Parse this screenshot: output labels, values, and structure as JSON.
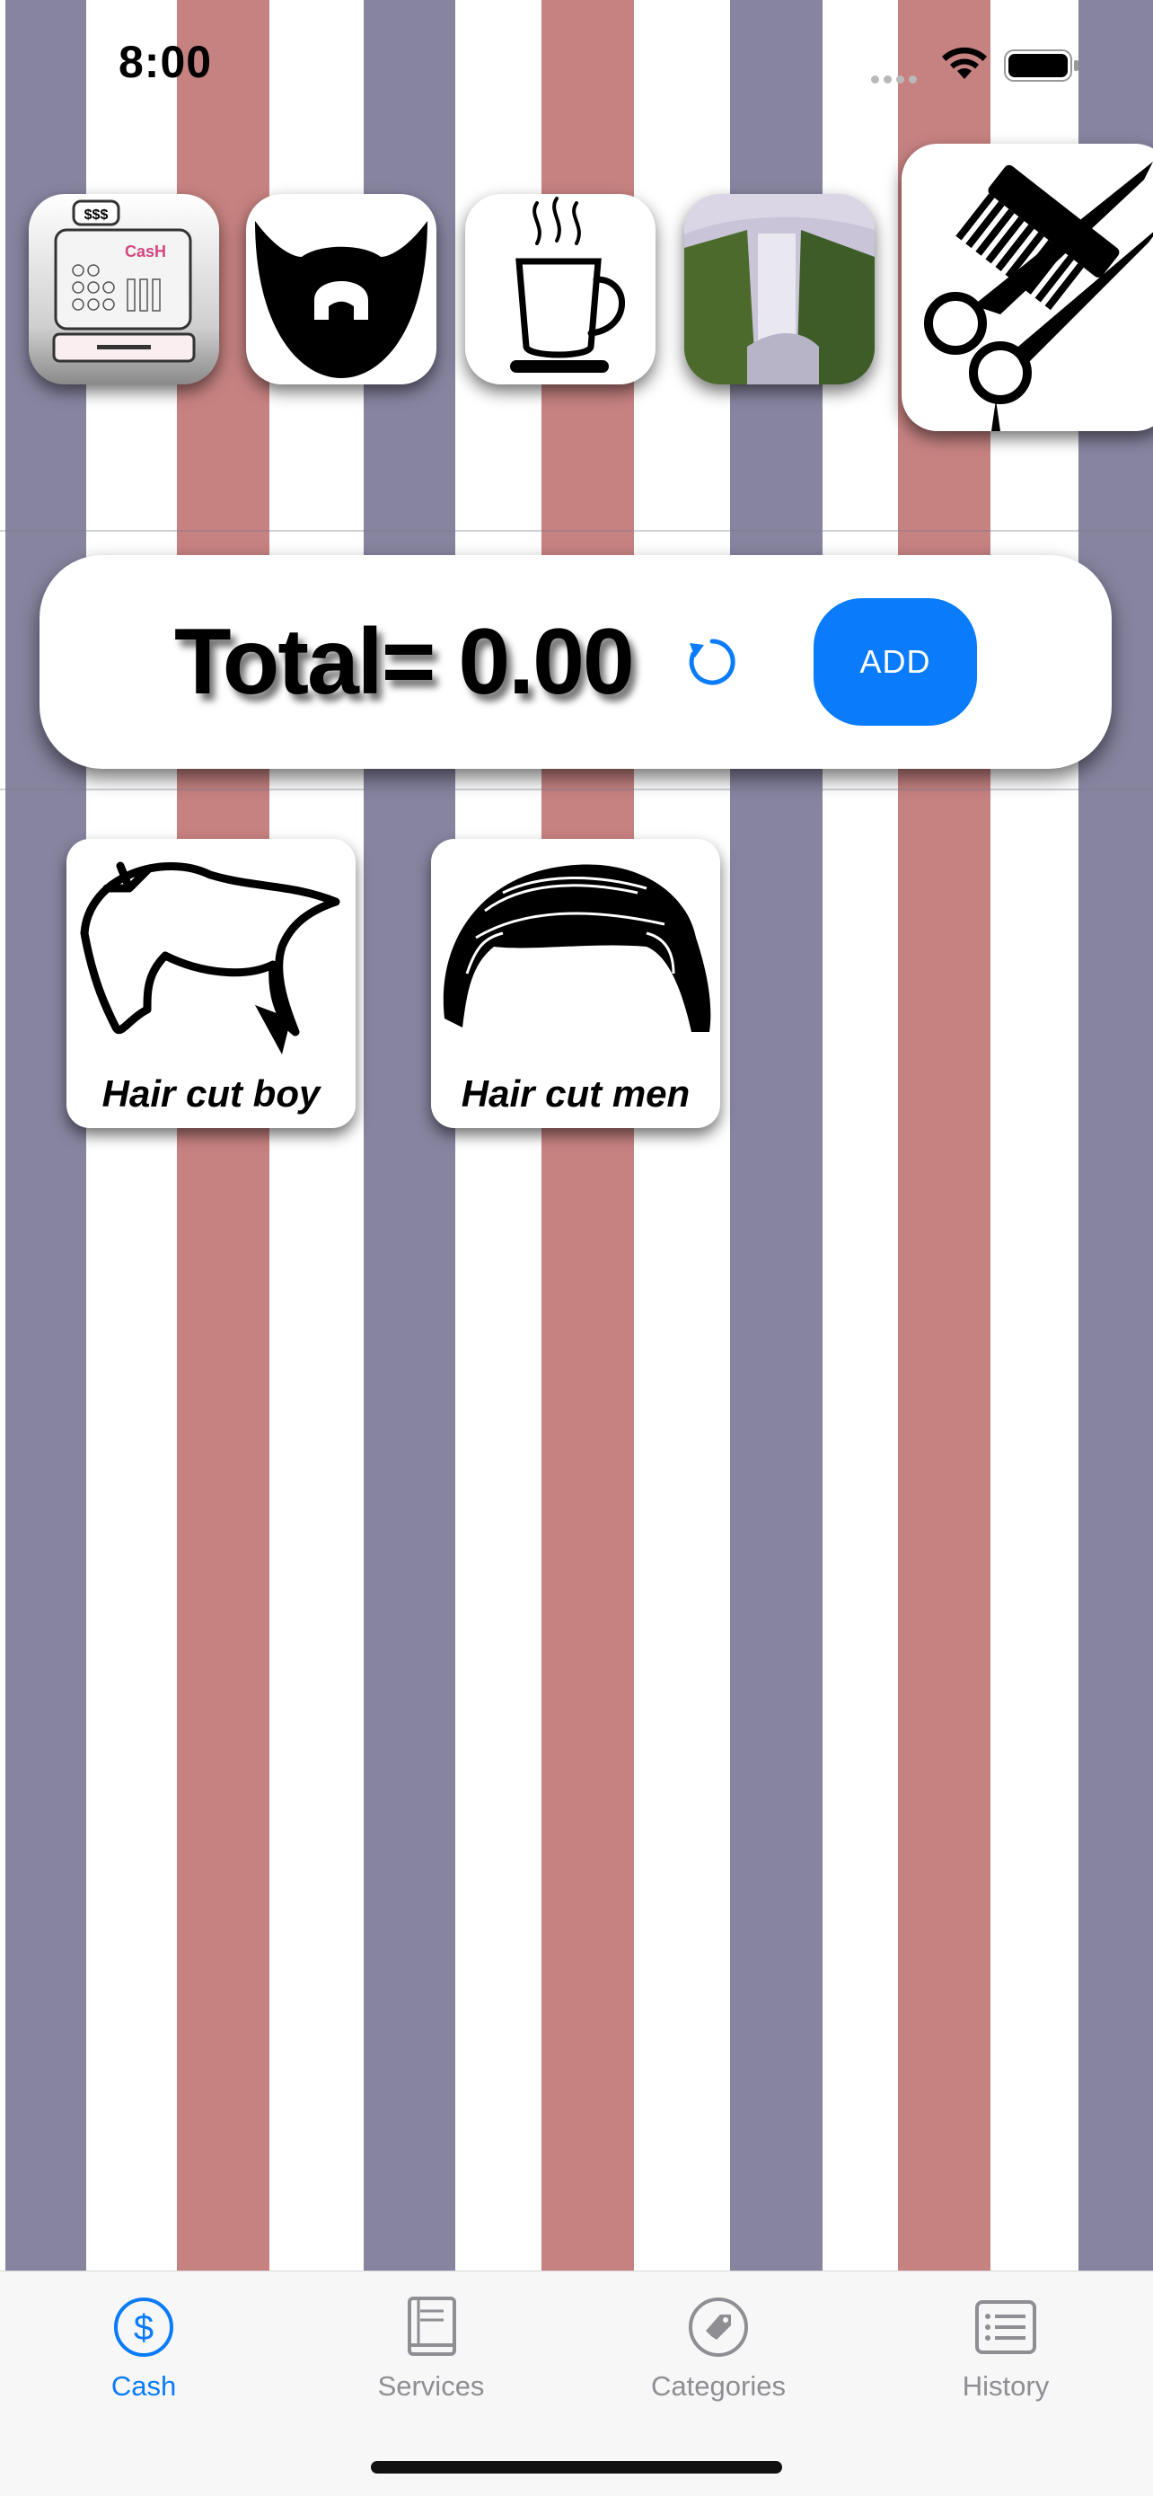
{
  "status_bar": {
    "time": "8:00"
  },
  "categories": [
    {
      "name": "cash-register",
      "icon": "cash-register-icon",
      "label": "CasH"
    },
    {
      "name": "beard",
      "icon": "beard-icon"
    },
    {
      "name": "coffee",
      "icon": "coffee-cup-icon"
    },
    {
      "name": "waterfall",
      "icon": "waterfall-image"
    },
    {
      "name": "haircut",
      "icon": "comb-scissors-icon"
    }
  ],
  "total": {
    "label": "Total= 0.00",
    "reset_icon": "refresh-icon",
    "add_label": "ADD"
  },
  "services": [
    {
      "label": "Hair cut boy",
      "icon": "boy-hair-icon"
    },
    {
      "label": "Hair cut men",
      "icon": "men-hair-icon"
    }
  ],
  "tabs": [
    {
      "label": "Cash",
      "icon": "dollar-circle-icon",
      "active": true
    },
    {
      "label": "Services",
      "icon": "book-icon",
      "active": false
    },
    {
      "label": "Categories",
      "icon": "tag-icon",
      "active": false
    },
    {
      "label": "History",
      "icon": "list-icon",
      "active": false
    }
  ],
  "colors": {
    "stripe_blue": "#8784a0",
    "stripe_red": "#c68281",
    "accent": "#0a7cfb",
    "tab_inactive": "#8e8e93"
  }
}
